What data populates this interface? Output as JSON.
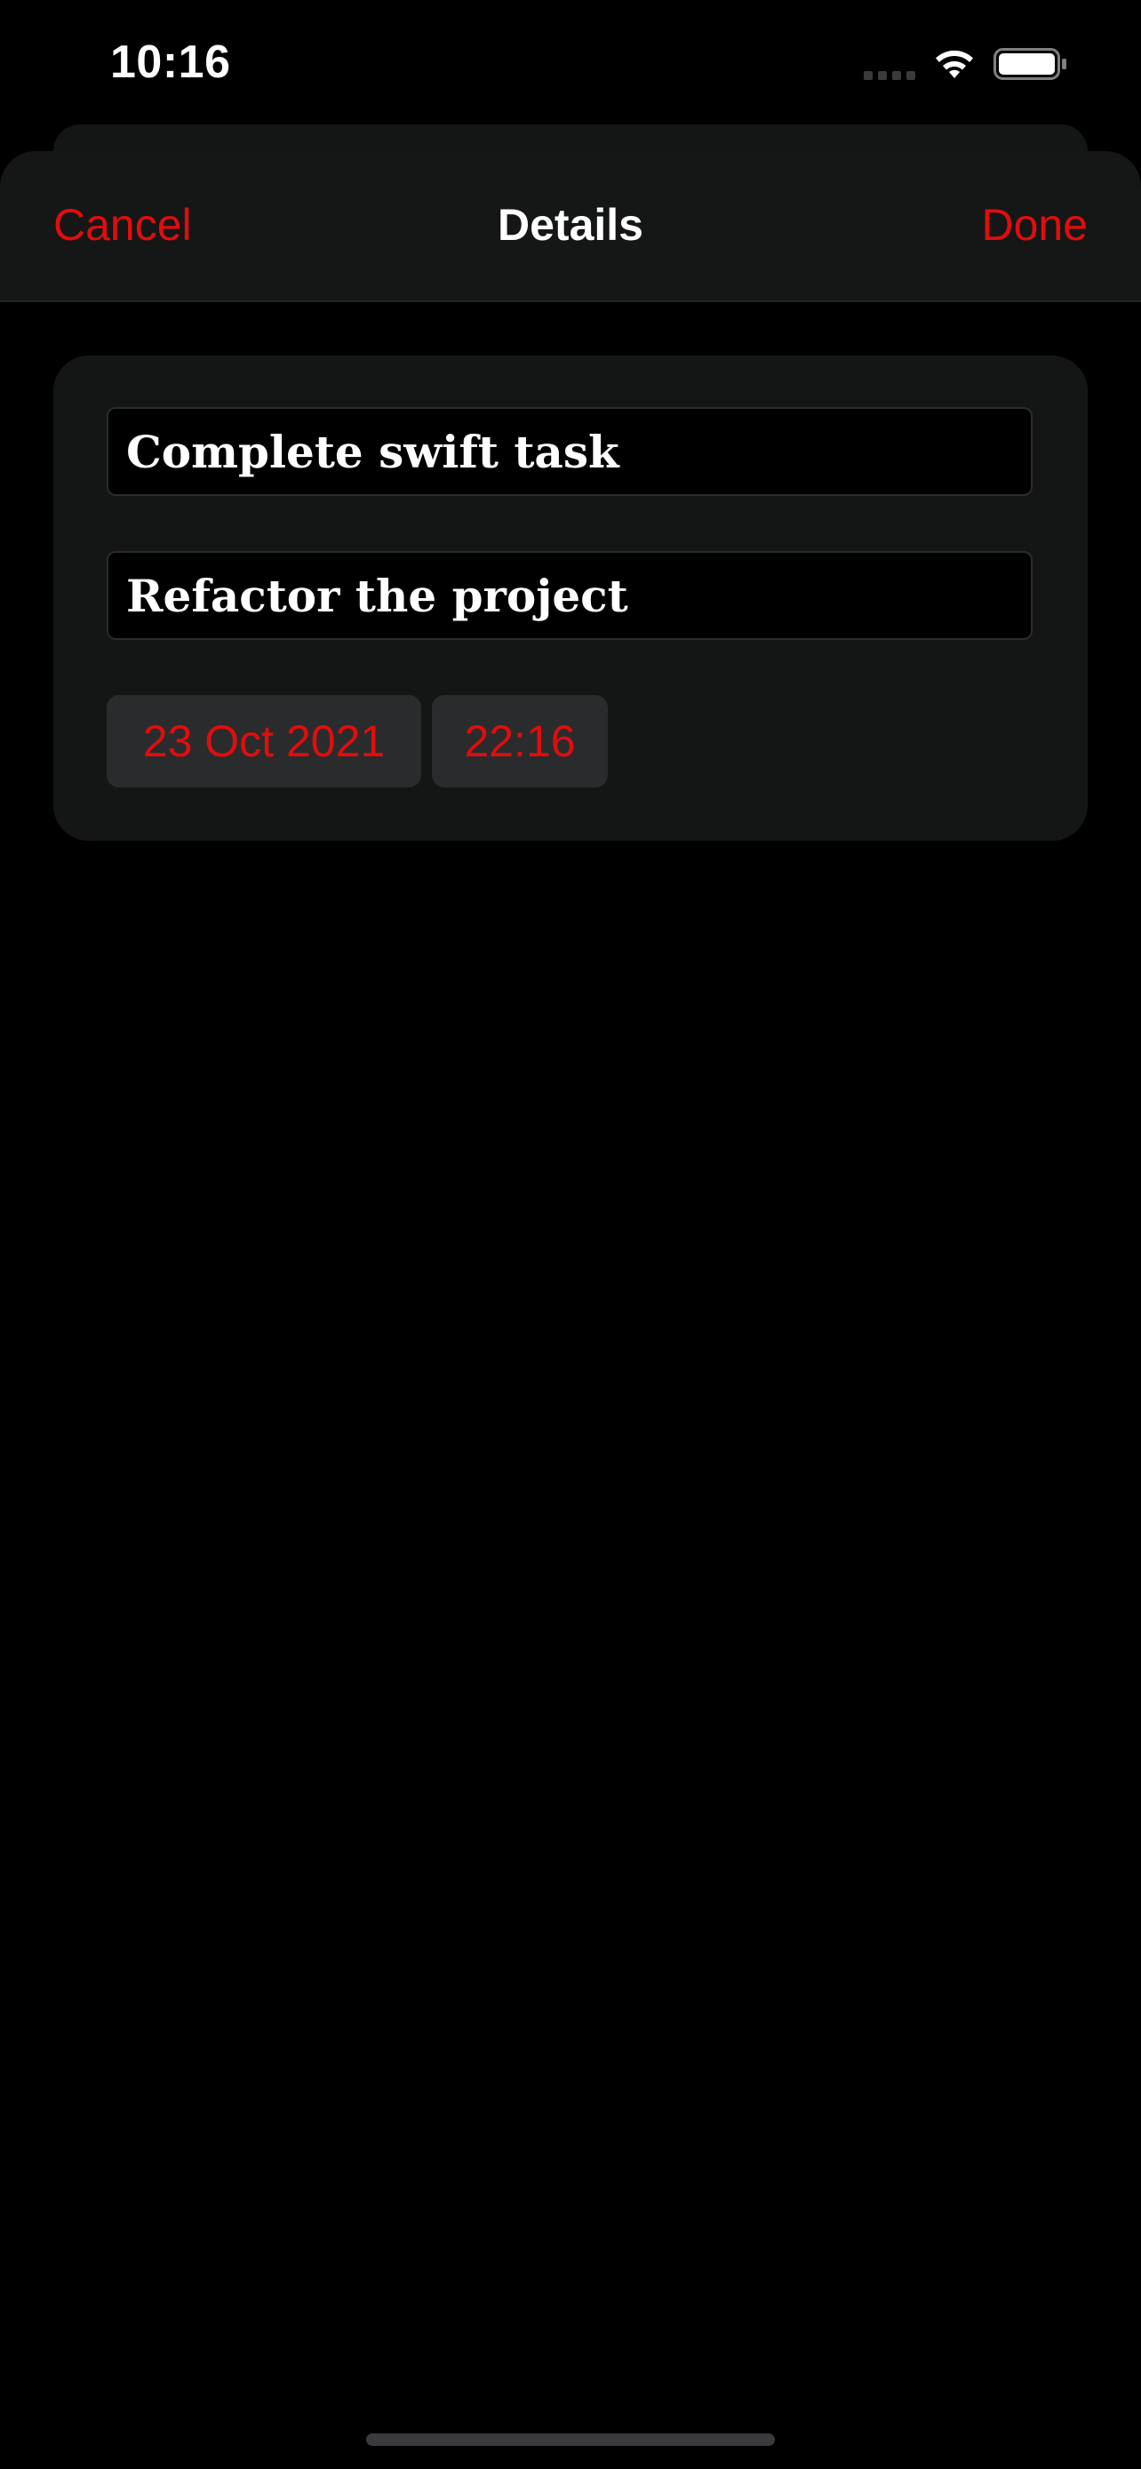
{
  "status_bar": {
    "time": "10:16",
    "icons": [
      "signal-icon",
      "wifi-icon",
      "battery-icon"
    ]
  },
  "nav": {
    "cancel_label": "Cancel",
    "title": "Details",
    "done_label": "Done"
  },
  "form": {
    "title_value": "Complete swift task",
    "notes_value": "Refactor the project",
    "date_value": "23 Oct 2021",
    "time_value": "22:16"
  },
  "colors": {
    "accent": "#e00d0d",
    "background": "#000000",
    "card": "#141515",
    "pill": "#2a2b2c"
  }
}
